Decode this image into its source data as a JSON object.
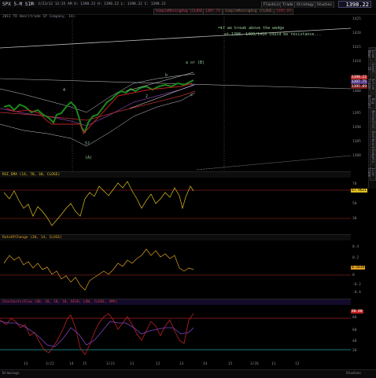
{
  "toolbar": {
    "symbol_line": "SPX 5-M SIM",
    "ohlc_text": "D: 3/23/12 12:35 AM O: 1398.22 H: 1398.22 L: 1398.22 C: 1398.22",
    "price": "1398.22",
    "buttons": [
      "FlashLink",
      "Trade",
      "Strategy",
      "Studies"
    ]
  },
  "info": {
    "chip1": "SimpleMovingAvg (CLOSE, 20, 0)",
    "chip2": "1397.75",
    "chip3": "SimpleMovingAvg (CLOSE, 200, 0)",
    "chip4": "1395.69"
  },
  "copyright": "2011 TD Ameritrade IP Company, Inc.",
  "side_tabs": [
    "Live News",
    "Level II",
    "Active Trader",
    "Big Buttons",
    "Notes",
    "Chat",
    "Dashboard",
    "Gadgets",
    "Live Trade"
  ],
  "annotations": {
    "note": "if we break above the wedge",
    "note2": "at 1398, 1400/1410 could be resistance...",
    "wave4": "4",
    "wave5": "5",
    "wave_ab": "a or (B)",
    "wave_c": "c",
    "wave_A": "(A)",
    "wave_57": "5?",
    "wave_b": "b",
    "wave_2": "2"
  },
  "price_axis": {
    "labels": [
      "1425",
      "1420",
      "1415",
      "1410",
      "1405",
      "1400",
      "1395",
      "1390",
      "1385",
      "1380",
      "1375"
    ],
    "badges": [
      {
        "value": "1398.22",
        "color": "#c03030"
      },
      {
        "value": "1397.75",
        "color": "#5a3a8a"
      },
      {
        "value": "1395.69",
        "color": "#7a1a1a"
      }
    ]
  },
  "panels": {
    "rsi": {
      "header": "RSI_EMA (14, 70, 30, CLOSE)",
      "value": "67.9621",
      "color": "#e0c020",
      "labels": [
        "70",
        "50",
        "30"
      ]
    },
    "roc": {
      "header": "RateOfChange (30, 14, CLOSE)",
      "value": "0.1619",
      "color": "#e0a020",
      "labels": [
        "0.4",
        "0.2",
        "0",
        "-0.2",
        "-0.4"
      ]
    },
    "stoch": {
      "header": "StochasticSlow (80, 20, 10, 10, HIGH, LOW, CLOSE, SMA)",
      "value": "80.00",
      "color": "#c02020",
      "labels": [
        "80",
        "60",
        "40",
        "20"
      ]
    }
  },
  "time_axis": [
    "13",
    "3/22",
    "14",
    "15",
    "3/23",
    "11",
    "12",
    "13",
    "14",
    "15",
    "3/26",
    "11",
    "12"
  ],
  "status": {
    "left": "Drawings",
    "right": "Studies"
  }
}
